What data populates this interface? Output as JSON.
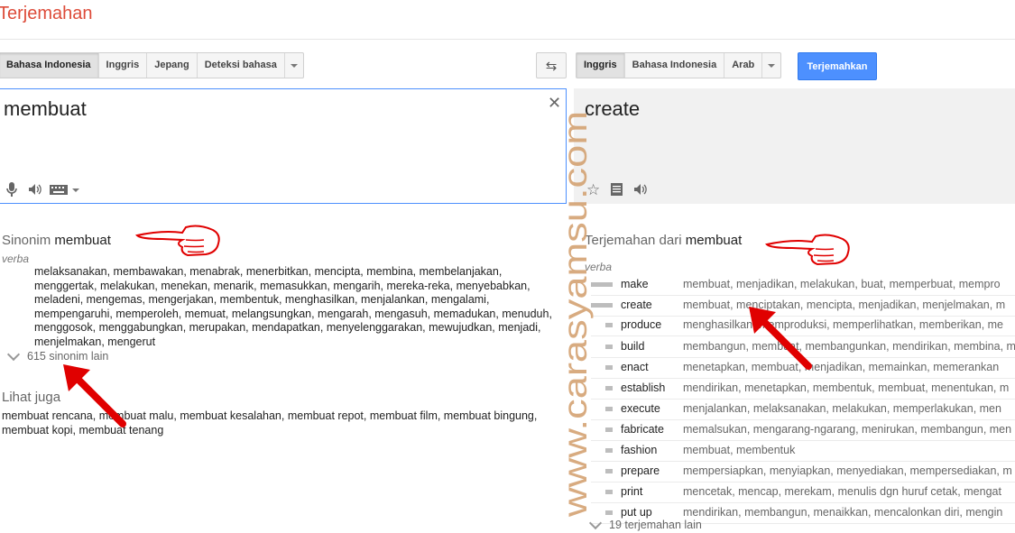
{
  "app": {
    "title": "Terjemahan"
  },
  "source_langs": {
    "buttons": [
      "Bahasa Indonesia",
      "Inggris",
      "Jepang",
      "Deteksi bahasa"
    ],
    "selected": "Bahasa Indonesia"
  },
  "target_langs": {
    "buttons": [
      "Inggris",
      "Bahasa Indonesia",
      "Arab"
    ],
    "selected": "Inggris"
  },
  "translate_button": "Terjemahkan",
  "source": {
    "text": "membuat"
  },
  "target": {
    "text": "create"
  },
  "synonyms": {
    "title_prefix": "Sinonim",
    "title_word": "membuat",
    "pos": "verba",
    "list": "melaksanakan, membawakan, menabrak, menerbitkan, mencipta, membina, membelanjakan, menggertak, melakukan, menekan, menarik, memasukkan, mengarih, mereka-reka, menyebabkan, meladeni, mengemas, mengerjakan, membentuk, menghasilkan, menjalankan, mengalami, mempengaruhi, memperoleh, memuat, melangsungkan, mengarah, mengasuh, memadukan, menuduh, menggosok, menggabungkan, merupakan, mendapatkan, menyelenggarakan, mewujudkan, menjadi, menjelmakan, mengerut",
    "more": "615 sinonim lain"
  },
  "see_also": {
    "title": "Lihat juga",
    "text": "membuat rencana, membuat malu, membuat kesalahan, membuat repot, membuat film, membuat bingung, membuat kopi, membuat tenang"
  },
  "translations": {
    "title_prefix": "Terjemahan dari",
    "title_word": "membuat",
    "pos": "verba",
    "rows": [
      {
        "word": "make",
        "alts": "membuat, menjadikan, melakukan, buat, memperbuat, mempro",
        "freq": 3
      },
      {
        "word": "create",
        "alts": "membuat, menciptakan, mencipta, menjadikan, menjelmakan, m",
        "freq": 3
      },
      {
        "word": "produce",
        "alts": "menghasilkan, memproduksi, memperlihatkan, memberikan, me",
        "freq": 1
      },
      {
        "word": "build",
        "alts": "membangun, membuat, membangunkan, mendirikan, membina, m",
        "freq": 1
      },
      {
        "word": "enact",
        "alts": "menetapkan, membuat, menjadikan, memainkan, memerankan",
        "freq": 1
      },
      {
        "word": "establish",
        "alts": "mendirikan, menetapkan, membentuk, membuat, menentukan, m",
        "freq": 1
      },
      {
        "word": "execute",
        "alts": "menjalankan, melaksanakan, melakukan, memperlakukan, men",
        "freq": 1
      },
      {
        "word": "fabricate",
        "alts": "memalsukan, mengarang-ngarang, menirukan, membangun, men",
        "freq": 1
      },
      {
        "word": "fashion",
        "alts": "membuat, membentuk",
        "freq": 1
      },
      {
        "word": "prepare",
        "alts": "mempersiapkan, menyiapkan, menyediakan, mempersediakan, m",
        "freq": 1
      },
      {
        "word": "print",
        "alts": "mencetak, mencap, merekam, menulis dgn huruf cetak, mengat",
        "freq": 1
      },
      {
        "word": "put up",
        "alts": "mendirikan, membangun, menaikkan, mencalonkan diri, mengin",
        "freq": 1
      }
    ],
    "more": "19 terjemahan lain"
  },
  "watermark": "www.carasyamsu.com",
  "colors": {
    "accent": "#4d90fe",
    "title": "#dd4b39",
    "watermark": "#d4a373",
    "annotation": "#e00000"
  }
}
